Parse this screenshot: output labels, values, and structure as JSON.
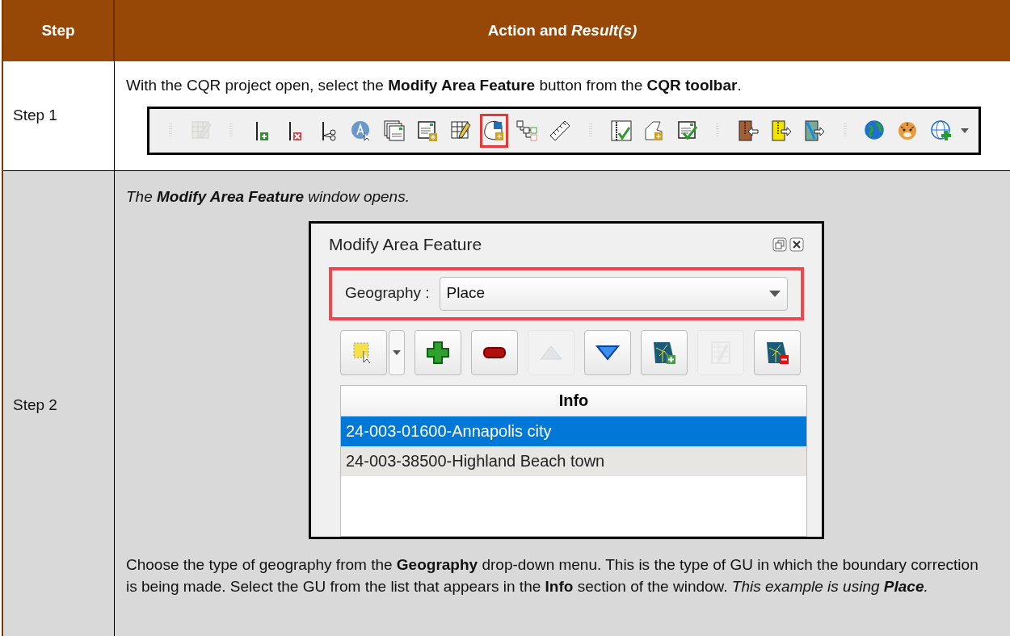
{
  "table": {
    "columns": [
      "Step",
      "Action and *Result(s)*"
    ],
    "rows": [
      {
        "step": "Step 1",
        "text": "With the CQR project open, select the **Modify Area Feature** button from the **CQR toolbar**."
      },
      {
        "step": "Step 2",
        "caption": "The **Modify Area Feature** window opens.",
        "text": "Choose the type of geography from the **Geography** drop-down menu. This is the type of GU in which the boundary correction is being made. Select the GU from the list that appears in the **Info** section of the window.",
        "note": "This example is using **Place**."
      }
    ]
  },
  "toolbar": [
    {
      "kind": "grip"
    },
    {
      "kind": "table-pencil",
      "disabled": true,
      "highlighted": false
    },
    {
      "kind": "grip"
    },
    {
      "kind": "line-plus",
      "disabled": false,
      "highlighted": false
    },
    {
      "kind": "line-x",
      "disabled": false,
      "highlighted": false
    },
    {
      "kind": "line-scissors",
      "disabled": false,
      "highlighted": false
    },
    {
      "kind": "label-cursor",
      "disabled": false,
      "highlighted": false
    },
    {
      "kind": "documents",
      "disabled": false,
      "highlighted": false
    },
    {
      "kind": "document-star",
      "disabled": false,
      "highlighted": false
    },
    {
      "kind": "table-pencil",
      "disabled": false,
      "highlighted": false
    },
    {
      "kind": "area-star",
      "disabled": false,
      "highlighted": true
    },
    {
      "kind": "tree",
      "disabled": false,
      "highlighted": false
    },
    {
      "kind": "ruler",
      "disabled": false,
      "highlighted": false
    },
    {
      "kind": "grip"
    },
    {
      "kind": "line-check",
      "disabled": false,
      "highlighted": false
    },
    {
      "kind": "shape-star",
      "disabled": false,
      "highlighted": false
    },
    {
      "kind": "document-check",
      "disabled": false,
      "highlighted": false
    },
    {
      "kind": "grip"
    },
    {
      "kind": "zip-in",
      "disabled": false,
      "highlighted": false
    },
    {
      "kind": "zip-out",
      "disabled": false,
      "highlighted": false
    },
    {
      "kind": "map-out",
      "disabled": false,
      "highlighted": false
    },
    {
      "kind": "grip"
    },
    {
      "kind": "globe",
      "disabled": false,
      "highlighted": false
    },
    {
      "kind": "tiger",
      "disabled": false,
      "highlighted": false
    },
    {
      "kind": "globe-plus",
      "disabled": false,
      "highlighted": false
    }
  ],
  "window": {
    "title": "Modify Area Feature",
    "geography_label": "Geography :",
    "geography_value": "Place",
    "highlighted": true,
    "tool_buttons": [
      {
        "kind": "select",
        "disabled": false
      },
      {
        "kind": "add",
        "disabled": false
      },
      {
        "kind": "remove",
        "disabled": false
      },
      {
        "kind": "up",
        "disabled": true
      },
      {
        "kind": "down",
        "disabled": false
      },
      {
        "kind": "map-add",
        "disabled": false
      },
      {
        "kind": "edit-table",
        "disabled": true
      },
      {
        "kind": "map-remove",
        "disabled": false
      }
    ],
    "list_header": "Info",
    "items": [
      {
        "label": "24-003-01600-Annapolis city",
        "selected": true
      },
      {
        "label": "24-003-38500-Highland Beach town",
        "selected": false
      }
    ]
  }
}
